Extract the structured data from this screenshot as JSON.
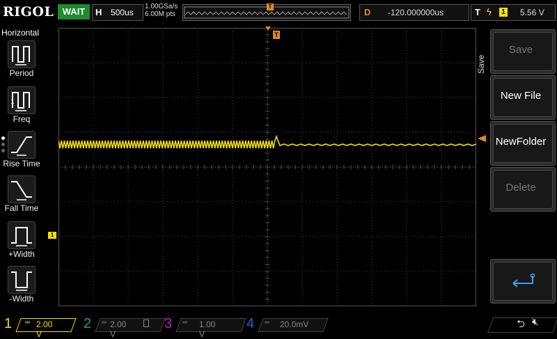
{
  "header": {
    "logo": "RIGOL",
    "run_status": "WAIT",
    "horizontal_key": "H",
    "horizontal_scale": "500us",
    "sample_rate": "1.00GSa/s",
    "memory_depth": "6.00M pts",
    "trigger_marker": "T",
    "delay_key": "D",
    "delay_value": "-120.000000us",
    "trigger_key": "T",
    "trigger_channel": "1",
    "trigger_level": "5.56 V"
  },
  "left_menu": {
    "title": "Horizontal",
    "items": [
      {
        "label": "Period"
      },
      {
        "label": "Freq"
      },
      {
        "label": "Rise Time"
      },
      {
        "label": "Fall Time"
      },
      {
        "label": "+Width"
      },
      {
        "label": "-Width"
      }
    ]
  },
  "waveform": {
    "channel_marker": "1",
    "trigger_top_marker": "T",
    "color": "#f5e000"
  },
  "right_menu": {
    "title": "Save",
    "buttons": [
      {
        "label": "Save",
        "enabled": false
      },
      {
        "label": "New File",
        "enabled": true
      },
      {
        "label": "NewFolder",
        "enabled": true
      },
      {
        "label": "Delete",
        "enabled": false
      },
      {
        "label": "",
        "icon": "enter-icon"
      }
    ]
  },
  "channels": [
    {
      "num": "1",
      "scale": "2.00 V",
      "color": "#f5e000"
    },
    {
      "num": "2",
      "scale": "2.00 V",
      "color": "#1a9aa0"
    },
    {
      "num": "3",
      "scale": "1.00 V",
      "color": "#c020c0"
    },
    {
      "num": "4",
      "scale": "20.0mV",
      "color": "#2060d0"
    }
  ]
}
